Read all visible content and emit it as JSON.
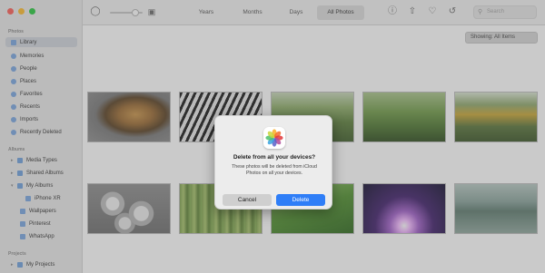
{
  "sidebar": {
    "photos_header": "Photos",
    "library_items": [
      {
        "label": "Library",
        "selected": true
      },
      {
        "label": "Memories"
      },
      {
        "label": "People"
      },
      {
        "label": "Places"
      },
      {
        "label": "Favorites"
      },
      {
        "label": "Recents"
      },
      {
        "label": "Imports"
      },
      {
        "label": "Recently Deleted"
      }
    ],
    "albums_header": "Albums",
    "album_items": [
      {
        "label": "Media Types"
      },
      {
        "label": "Shared Albums"
      },
      {
        "label": "My Albums"
      },
      {
        "label": "iPhone XR"
      },
      {
        "label": "Wallpapers"
      },
      {
        "label": "Pinterest"
      },
      {
        "label": "WhatsApp"
      }
    ],
    "projects_header": "Projects",
    "project_items": [
      {
        "label": "My Projects"
      }
    ]
  },
  "toolbar": {
    "tabs": [
      "Years",
      "Months",
      "Days",
      "All Photos"
    ],
    "active_tab": "All Photos",
    "search_placeholder": "Search"
  },
  "content": {
    "showing_label": "Showing: All Items",
    "photos": [
      "lion",
      "zebra",
      "forest",
      "forest",
      "temple",
      "stones",
      "bamboo",
      "leaf",
      "aurora",
      "zen garden"
    ]
  },
  "dialog": {
    "title": "Delete from all your devices?",
    "message": "These photos will be deleted from iCloud Photos on all your devices.",
    "cancel_label": "Cancel",
    "delete_label": "Delete"
  },
  "colors": {
    "accent": "#2f7ef7",
    "dim_overlay": "#5f5f5f"
  }
}
